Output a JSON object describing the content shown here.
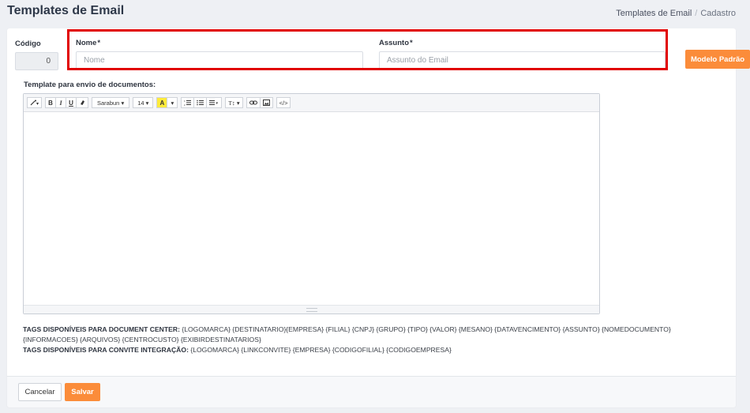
{
  "header": {
    "title": "Templates de Email",
    "breadcrumb": {
      "parent": "Templates de Email",
      "separator": "/",
      "current": "Cadastro"
    }
  },
  "form": {
    "codigo": {
      "label": "Código",
      "value": "0"
    },
    "nome": {
      "label": "Nome",
      "required_mark": "*",
      "placeholder": "Nome",
      "value": ""
    },
    "assunto": {
      "label": "Assunto",
      "required_mark": "*",
      "placeholder": "Assunto do Email",
      "value": ""
    },
    "modelo_button": "Modelo Padrão",
    "template_label": "Template para envio de documentos:"
  },
  "toolbar": {
    "style_icon": "magic-wand-icon",
    "bold": "B",
    "italic": "I",
    "underline": "U",
    "eraser_icon": "eraser-icon",
    "font_family": "Sarabun",
    "font_size": "14",
    "color_letter": "A",
    "ordered_list_icon": "ordered-list-icon",
    "unordered_list_icon": "unordered-list-icon",
    "align_icon": "align-icon",
    "line_height": "T↕",
    "link_icon": "link-icon",
    "image_icon": "image-icon",
    "code_view": "</>"
  },
  "tags": {
    "document_center_label": "TAGS DISPONÍVEIS PARA DOCUMENT CENTER:",
    "document_center_values": "{LOGOMARCA} {DESTINATARIO}{EMPRESA} {FILIAL} {CNPJ} {GRUPO} {TIPO} {VALOR} {MESANO} {DATAVENCIMENTO} {ASSUNTO} {NOMEDOCUMENTO} {INFORMACOES} {ARQUIVOS} {CENTROCUSTO} {EXIBIRDESTINATARIOS}",
    "convite_label": "TAGS DISPONÍVEIS PARA CONVITE INTEGRAÇÃO:",
    "convite_values": "{LOGOMARCA} {LINKCONVITE} {EMPRESA} {CODIGOFILIAL} {CODIGOEMPRESA}"
  },
  "footer": {
    "cancel_label": "Cancelar",
    "save_label": "Salvar"
  },
  "colors": {
    "accent": "#fb8c3a",
    "highlight": "#e10000",
    "background": "#eef0f4"
  }
}
